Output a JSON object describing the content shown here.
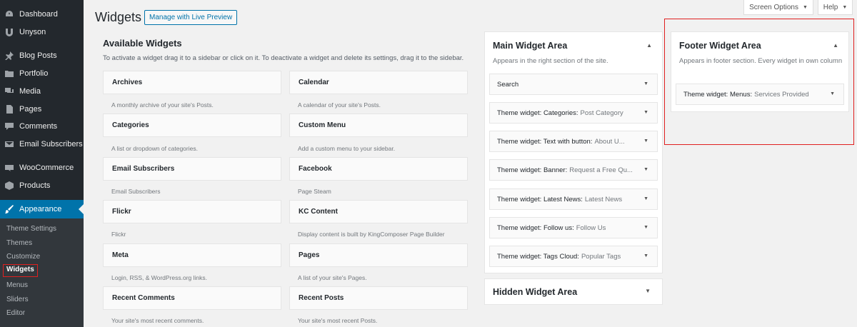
{
  "sidebar": {
    "items": [
      {
        "label": "Dashboard",
        "icon": "dashboard-icon"
      },
      {
        "label": "Unyson",
        "icon": "unyson-icon"
      },
      {
        "label": "Blog Posts",
        "icon": "pin-icon"
      },
      {
        "label": "Portfolio",
        "icon": "folder-icon"
      },
      {
        "label": "Media",
        "icon": "media-icon"
      },
      {
        "label": "Pages",
        "icon": "page-icon"
      },
      {
        "label": "Comments",
        "icon": "comment-icon"
      },
      {
        "label": "Email Subscribers",
        "icon": "email-icon"
      },
      {
        "label": "WooCommerce",
        "icon": "woo-icon"
      },
      {
        "label": "Products",
        "icon": "products-icon"
      },
      {
        "label": "Appearance",
        "icon": "brush-icon"
      }
    ],
    "submenu": [
      "Theme Settings",
      "Themes",
      "Customize",
      "Widgets",
      "Menus",
      "Sliders",
      "Editor"
    ]
  },
  "header": {
    "title": "Widgets",
    "preview_button": "Manage with Live Preview",
    "screen_options": "Screen Options",
    "help": "Help"
  },
  "available": {
    "title": "Available Widgets",
    "description": "To activate a widget drag it to a sidebar or click on it. To deactivate a widget and delete its settings, drag it to the sidebar.",
    "widgets": [
      {
        "name": "Archives",
        "desc": "A monthly archive of your site's Posts."
      },
      {
        "name": "Calendar",
        "desc": "A calendar of your site's Posts."
      },
      {
        "name": "Categories",
        "desc": "A list or dropdown of categories."
      },
      {
        "name": "Custom Menu",
        "desc": "Add a custom menu to your sidebar."
      },
      {
        "name": "Email Subscribers",
        "desc": "Email Subscribers"
      },
      {
        "name": "Facebook",
        "desc": "Page Steam"
      },
      {
        "name": "Flickr",
        "desc": "Flickr"
      },
      {
        "name": "KC Content",
        "desc": "Display content is built by KingComposer Page Builder"
      },
      {
        "name": "Meta",
        "desc": "Login, RSS, & WordPress.org links."
      },
      {
        "name": "Pages",
        "desc": "A list of your site's Pages."
      },
      {
        "name": "Recent Comments",
        "desc": "Your site's most recent comments."
      },
      {
        "name": "Recent Posts",
        "desc": "Your site's most recent Posts."
      }
    ]
  },
  "main_area": {
    "title": "Main Widget Area",
    "description": "Appears in the right section of the site.",
    "widgets": [
      {
        "name": "Search",
        "title": ""
      },
      {
        "name": "Theme widget: Categories:",
        "title": "Post Category"
      },
      {
        "name": "Theme widget: Text with button:",
        "title": "About U..."
      },
      {
        "name": "Theme widget: Banner:",
        "title": "Request a Free Qu..."
      },
      {
        "name": "Theme widget: Latest News:",
        "title": "Latest News"
      },
      {
        "name": "Theme widget: Follow us:",
        "title": "Follow Us"
      },
      {
        "name": "Theme widget: Tags Cloud:",
        "title": "Popular Tags"
      }
    ]
  },
  "hidden_area": {
    "title": "Hidden Widget Area"
  },
  "footer_area": {
    "title": "Footer Widget Area",
    "description": "Appears in footer section. Every widget in own column",
    "widgets": [
      {
        "name": "Theme widget: Menus:",
        "title": "Services Provided"
      }
    ]
  },
  "colors": {
    "sidebar_bg": "#23282d",
    "accent": "#0073aa",
    "highlight": "#e02020"
  }
}
